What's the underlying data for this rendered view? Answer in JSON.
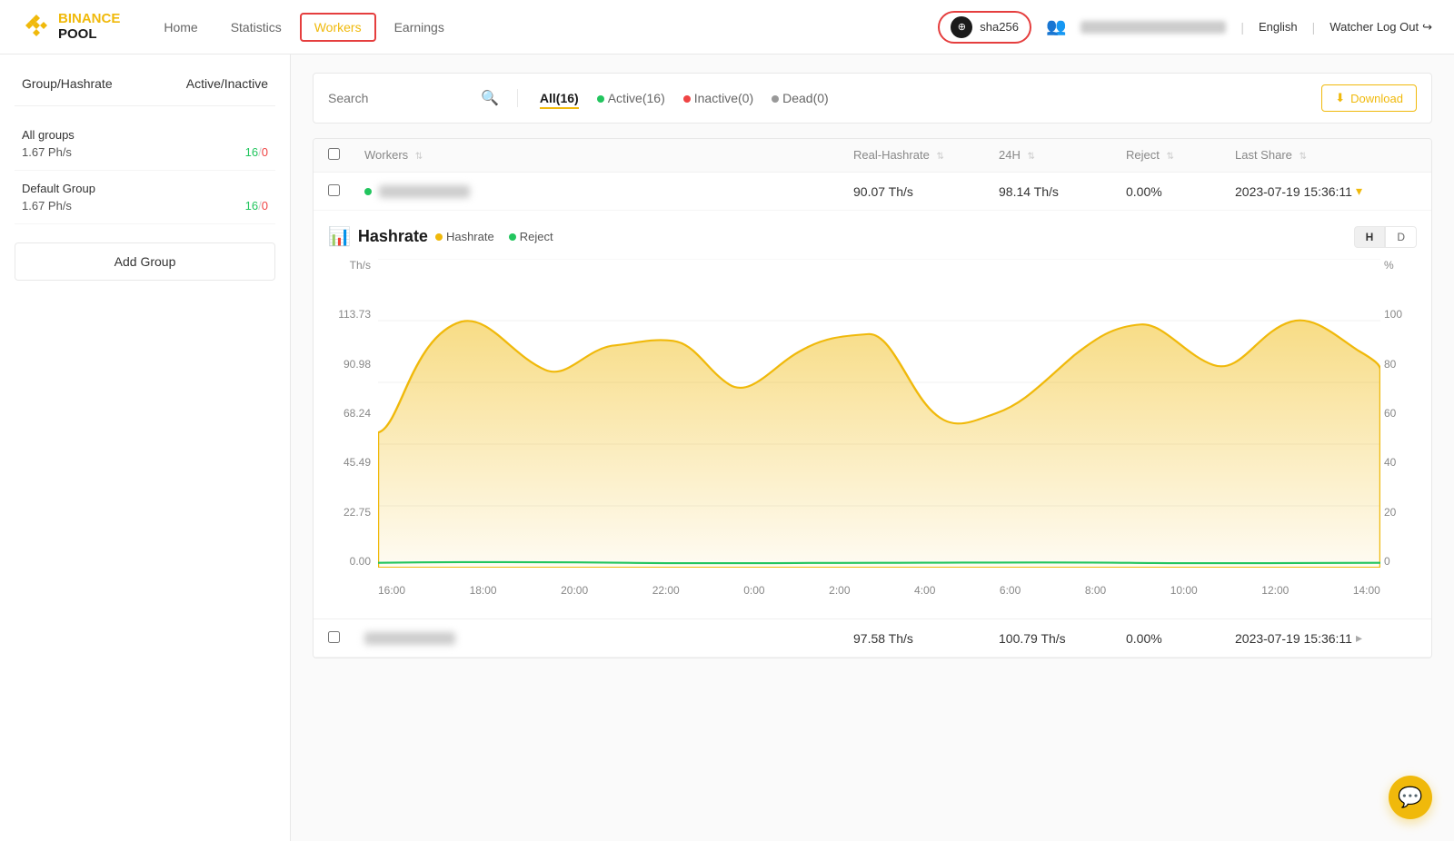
{
  "header": {
    "logo_name": "BINANCE",
    "logo_sub": "POOL",
    "nav": [
      {
        "label": "Home",
        "active": false
      },
      {
        "label": "Statistics",
        "active": false
      },
      {
        "label": "Workers",
        "active": true
      },
      {
        "label": "Earnings",
        "active": false
      }
    ],
    "account": {
      "avatar_text": "⊕",
      "name": "sha256"
    },
    "lang": "English",
    "logout_label": "Watcher Log Out"
  },
  "sidebar": {
    "col1_label": "Group/Hashrate",
    "col2_label": "Active/Inactive",
    "groups": [
      {
        "name": "All groups",
        "hashrate": "1.67 Ph/s",
        "active": "16",
        "inactive": "0"
      },
      {
        "name": "Default Group",
        "hashrate": "1.67 Ph/s",
        "active": "16",
        "inactive": "0"
      }
    ],
    "add_group_label": "Add Group"
  },
  "filter": {
    "search_placeholder": "Search",
    "tabs": [
      {
        "label": "All(16)",
        "active": true,
        "dot": "none"
      },
      {
        "label": "Active(16)",
        "active": false,
        "dot": "green"
      },
      {
        "label": "Inactive(0)",
        "active": false,
        "dot": "red"
      },
      {
        "label": "Dead(0)",
        "active": false,
        "dot": "gray"
      }
    ],
    "download_label": "Download"
  },
  "table": {
    "columns": [
      "Workers",
      "Real-Hashrate",
      "24H",
      "Reject",
      "Last Share"
    ],
    "row1": {
      "real_hashrate": "90.07 Th/s",
      "h24": "98.14 Th/s",
      "reject": "0.00%",
      "last_share": "2023-07-19 15:36:11"
    },
    "row2": {
      "real_hashrate": "97.58 Th/s",
      "h24": "100.79 Th/s",
      "reject": "0.00%",
      "last_share": "2023-07-19 15:36:11"
    }
  },
  "chart": {
    "title": "Hashrate",
    "legend_hashrate": "Hashrate",
    "legend_reject": "Reject",
    "toggle_h": "H",
    "toggle_d": "D",
    "y_labels": [
      "113.73",
      "90.98",
      "68.24",
      "45.49",
      "22.75",
      "0.00"
    ],
    "y_right_labels": [
      "100",
      "80",
      "60",
      "40",
      "20",
      "0"
    ],
    "x_labels": [
      "16:00",
      "18:00",
      "20:00",
      "22:00",
      "0:00",
      "2:00",
      "4:00",
      "6:00",
      "8:00",
      "10:00",
      "12:00",
      "14:00"
    ],
    "y_axis_label": "Th/s",
    "y_axis_right_label": "%"
  },
  "chat_fab": "💬"
}
